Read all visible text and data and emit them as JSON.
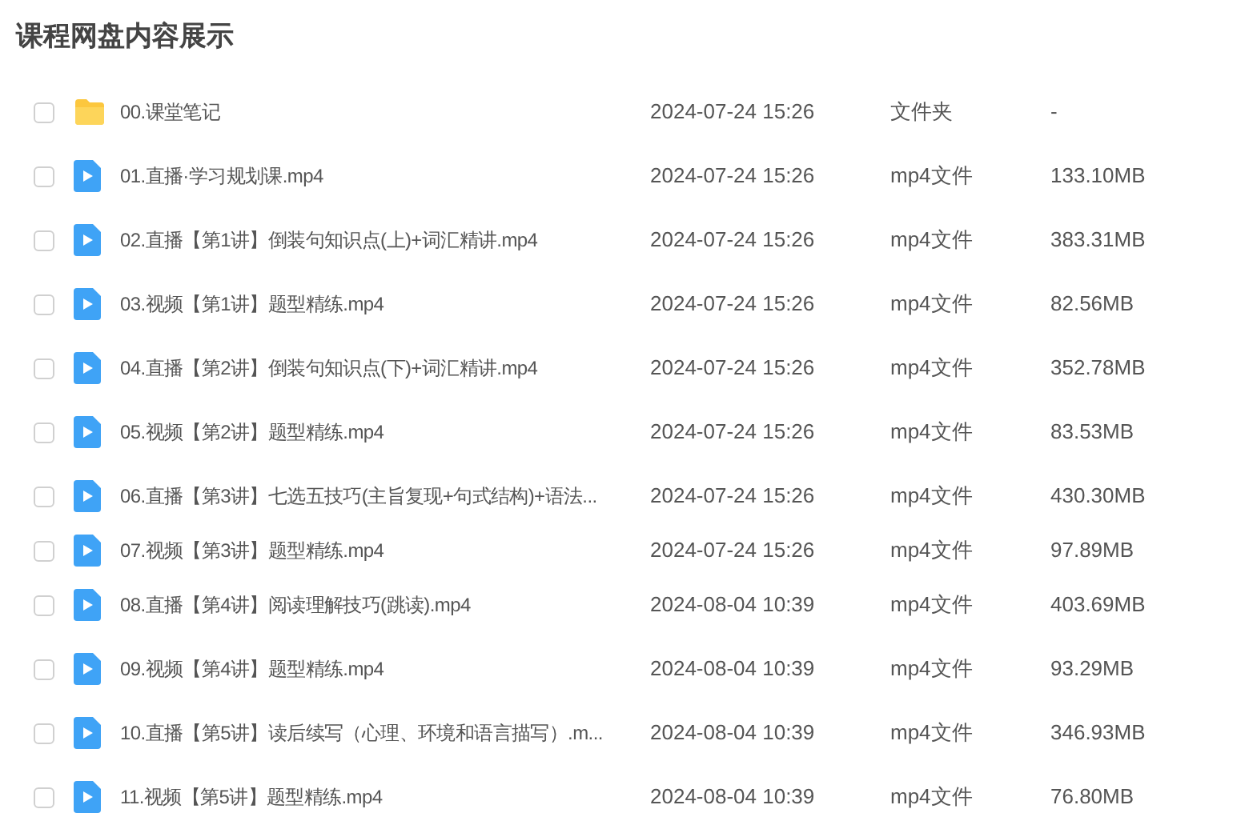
{
  "title": "课程网盘内容展示",
  "files": [
    {
      "kind": "folder",
      "name": "00.课堂笔记",
      "date": "2024-07-24 15:26",
      "type": "文件夹",
      "size": "-",
      "checked": false
    },
    {
      "kind": "video",
      "name": "01.直播·学习规划课.mp4",
      "date": "2024-07-24 15:26",
      "type": "mp4文件",
      "size": "133.10MB",
      "checked": false
    },
    {
      "kind": "video",
      "name": "02.直播【第1讲】倒装句知识点(上)+词汇精讲.mp4",
      "date": "2024-07-24 15:26",
      "type": "mp4文件",
      "size": "383.31MB",
      "checked": false
    },
    {
      "kind": "video",
      "name": "03.视频【第1讲】题型精练.mp4",
      "date": "2024-07-24 15:26",
      "type": "mp4文件",
      "size": "82.56MB",
      "checked": false
    },
    {
      "kind": "video",
      "name": "04.直播【第2讲】倒装句知识点(下)+词汇精讲.mp4",
      "date": "2024-07-24 15:26",
      "type": "mp4文件",
      "size": "352.78MB",
      "checked": false
    },
    {
      "kind": "video",
      "name": "05.视频【第2讲】题型精练.mp4",
      "date": "2024-07-24 15:26",
      "type": "mp4文件",
      "size": "83.53MB",
      "checked": false
    },
    {
      "kind": "video",
      "name": "06.直播【第3讲】七选五技巧(主旨复现+句式结构)+语法...",
      "date": "2024-07-24 15:26",
      "type": "mp4文件",
      "size": "430.30MB",
      "checked": false
    },
    {
      "kind": "video",
      "name": "07.视频【第3讲】题型精练.mp4",
      "date": "2024-07-24 15:26",
      "type": "mp4文件",
      "size": "97.89MB",
      "checked": false
    },
    {
      "kind": "video",
      "name": "08.直播【第4讲】阅读理解技巧(跳读).mp4",
      "date": "2024-08-04 10:39",
      "type": "mp4文件",
      "size": "403.69MB",
      "checked": false
    },
    {
      "kind": "video",
      "name": "09.视频【第4讲】题型精练.mp4",
      "date": "2024-08-04 10:39",
      "type": "mp4文件",
      "size": "93.29MB",
      "checked": false
    },
    {
      "kind": "video",
      "name": "10.直播【第5讲】读后续写（心理、环境和语言描写）.m...",
      "date": "2024-08-04 10:39",
      "type": "mp4文件",
      "size": "346.93MB",
      "checked": false
    },
    {
      "kind": "video",
      "name": "11.视频【第5讲】题型精练.mp4",
      "date": "2024-08-04 10:39",
      "type": "mp4文件",
      "size": "76.80MB",
      "checked": false
    }
  ]
}
